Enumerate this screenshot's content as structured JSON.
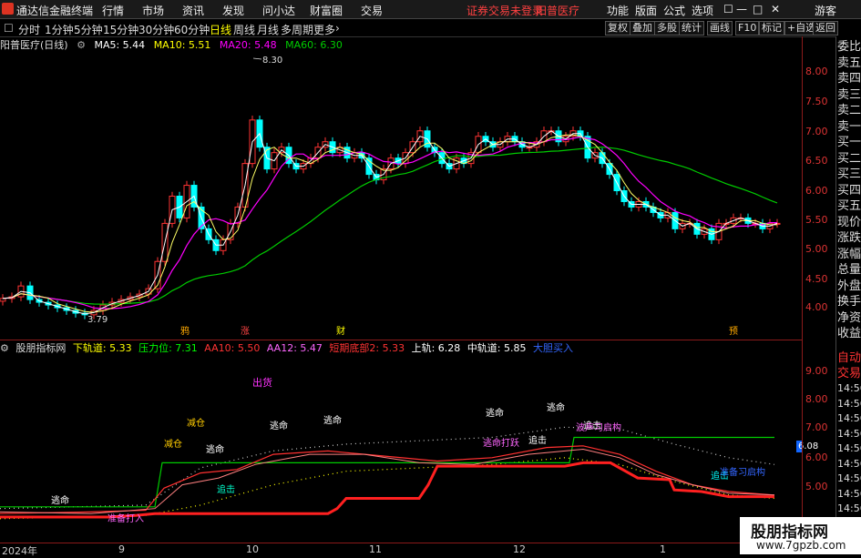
{
  "menubar": {
    "app_title": "通达信金融终端",
    "items": [
      "行情",
      "市场",
      "资讯",
      "发现",
      "问小达",
      "财富圈",
      "交易"
    ],
    "notice": "证券交易未登录",
    "stock_name": "阳普医疗",
    "right_items": [
      "功能",
      "版面",
      "公式",
      "选项"
    ],
    "guest": "游客"
  },
  "periods": [
    "分时",
    "1分钟",
    "5分钟",
    "15分钟",
    "30分钟",
    "60分钟",
    "日线",
    "周线",
    "月线",
    "多周期",
    "更多"
  ],
  "active_period": "日线",
  "toolbar_buttons": [
    "复权",
    "叠加",
    "多股",
    "统计",
    "画线",
    "F10",
    "标记",
    "+自选",
    "返回"
  ],
  "main_indicator": {
    "title": "阳普医疗(日线)",
    "ma5": "MA5: 5.44",
    "ma10": "MA10: 5.51",
    "ma20": "MA20: 5.48",
    "ma60": "MA60: 6.30",
    "high_label": "8.30",
    "low_label": "3.79",
    "markers": [
      "鸦",
      "涨",
      "财",
      "预"
    ]
  },
  "main_y_labels": [
    "8.00",
    "7.50",
    "7.00",
    "6.50",
    "6.00",
    "5.50",
    "5.00",
    "4.50",
    "4.00"
  ],
  "sub_indicator": {
    "name": "股朋指标网",
    "lower": "下轨道: 5.33",
    "pressure": "压力位: 7.31",
    "aa10": "AA10: 5.50",
    "aa12": "AA12: 5.47",
    "bottom": "短期底部2: 5.33",
    "upper": "上轨: 6.28",
    "mid": "中轨道: 5.85",
    "buy": "大胆买入",
    "labels": [
      "出货",
      "减仓",
      "减仓",
      "逃命",
      "逃命",
      "逃命",
      "逃命",
      "逃命",
      "逃命",
      "追击",
      "追击",
      "追击",
      "追击",
      "准备打入",
      "逃命打跃",
      "波声习启构",
      "准备习启构",
      "追击"
    ],
    "value_tag": "6.08"
  },
  "sub_y_labels": [
    "9.00",
    "8.00",
    "7.00",
    "6.00",
    "5.00"
  ],
  "dates": [
    "2024年",
    "9",
    "10",
    "11",
    "12",
    "1"
  ],
  "right_panel": [
    "委比",
    "卖五",
    "卖四",
    "卖三",
    "卖二",
    "卖一",
    "买一",
    "买二",
    "买三",
    "买四",
    "买五",
    "现价",
    "涨跌",
    "涨幅",
    "总量",
    "外盘",
    "换手",
    "净资",
    "收益"
  ],
  "right_panel_lower": [
    "自动",
    "交易",
    "14:56",
    "14:56",
    "14:56",
    "14:56",
    "14:56",
    "14:56",
    "14:56",
    "14:56",
    "14:56",
    "14:56"
  ],
  "watermark": {
    "title": "股朋指标网",
    "url": "www.7gpzb.com"
  },
  "colors": {
    "up": "#ff3333",
    "down": "#00ffff",
    "ma5": "#ffffff",
    "ma10": "#ffff00",
    "ma20": "#ff00ff",
    "ma60": "#00cc00",
    "axis": "#8b1a1a"
  }
}
